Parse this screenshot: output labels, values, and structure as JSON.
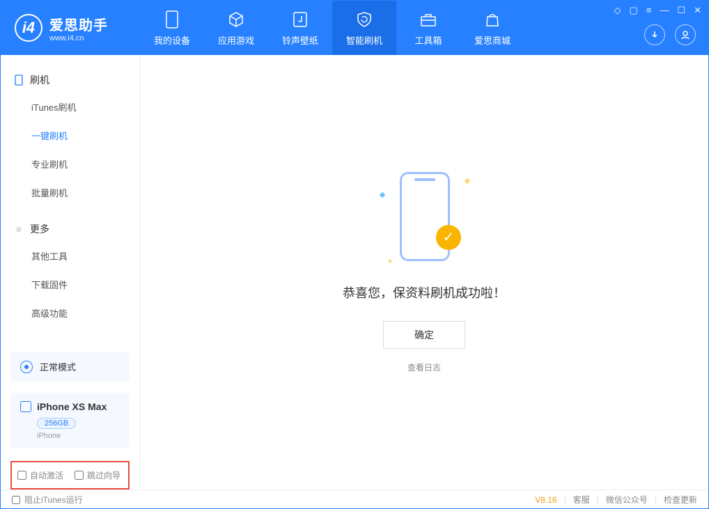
{
  "app": {
    "title": "爱思助手",
    "subtitle": "www.i4.cn"
  },
  "nav": {
    "tabs": [
      {
        "label": "我的设备"
      },
      {
        "label": "应用游戏"
      },
      {
        "label": "铃声壁纸"
      },
      {
        "label": "智能刷机"
      },
      {
        "label": "工具箱"
      },
      {
        "label": "爱思商城"
      }
    ]
  },
  "sidebar": {
    "section1_title": "刷机",
    "items1": [
      {
        "label": "iTunes刷机"
      },
      {
        "label": "一键刷机"
      },
      {
        "label": "专业刷机"
      },
      {
        "label": "批量刷机"
      }
    ],
    "section2_title": "更多",
    "items2": [
      {
        "label": "其他工具"
      },
      {
        "label": "下载固件"
      },
      {
        "label": "高级功能"
      }
    ],
    "mode_label": "正常模式",
    "device": {
      "name": "iPhone XS Max",
      "storage": "256GB",
      "type": "iPhone"
    },
    "checks": {
      "auto_activate": "自动激活",
      "skip_guide": "跳过向导"
    }
  },
  "main": {
    "success_msg": "恭喜您，保资料刷机成功啦！",
    "ok_label": "确定",
    "log_link": "查看日志"
  },
  "footer": {
    "block_itunes": "阻止iTunes运行",
    "version": "V8.16",
    "links": {
      "service": "客服",
      "wechat": "微信公众号",
      "update": "检查更新"
    }
  }
}
